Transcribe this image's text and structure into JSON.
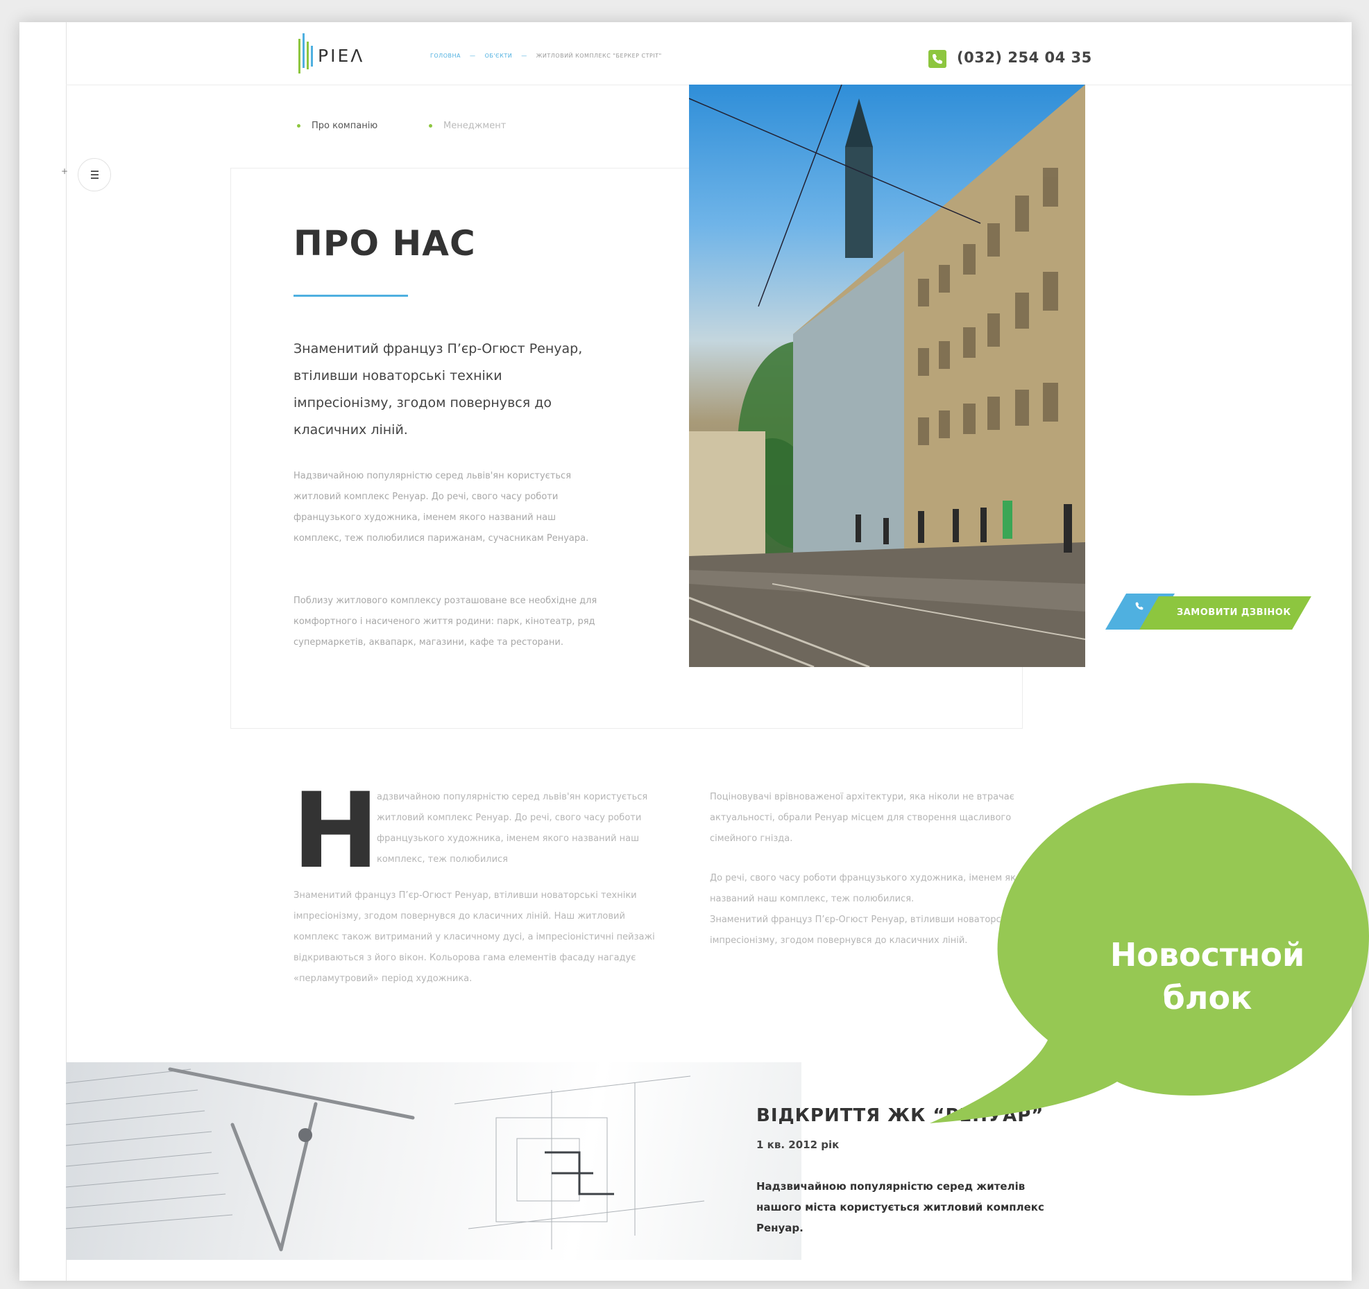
{
  "header": {
    "logo_text": "PIEΛ",
    "breadcrumb": {
      "home": "ГОЛОВНА",
      "sep1": "—",
      "objects": "ОБ'ЄКТИ",
      "sep2": "—",
      "current": "ЖИТЛОВИЙ КОМПЛЕКС \"БЕРКЕР СТРІТ\""
    },
    "phone": "(032) 254 04 35",
    "phone_icon": "phone-icon"
  },
  "subnav": {
    "items": [
      {
        "label": "Про компанію",
        "active": true
      },
      {
        "label": "Менеджмент",
        "active": false
      }
    ]
  },
  "menu": {
    "icon": "hamburger-icon",
    "plus": "+"
  },
  "about": {
    "title": "ПРО НАС",
    "lead": "Знаменитий француз П’єр-Огюст Ренуар, втіливши новаторські техніки імпресіонізму, згодом повернувся до класичних ліній.",
    "p1": "Надзвичайною популярністю серед львів'ян користується житловий комплекс Ренуар. До речі, свого часу роботи французького художника, іменем якого названий наш комплекс, теж полюбилися парижанам, сучасникам Ренуара.",
    "p2": "Поблизу житлового комплексу розташоване все необхідне для комфортного і насиченого життя родини: парк, кінотеатр, ряд супермаркетів, аквапарк, магазини, кафе та ресторани."
  },
  "call_button": {
    "label": "ЗАМОВИТИ ДЗВІНОК",
    "icon": "phone-icon"
  },
  "article": {
    "dropcap": "Н",
    "col1_intro": "адзвичайною популярністю серед львів'ян користується житловий комплекс Ренуар. До речі, свого часу роботи французького художника, іменем якого названий наш комплекс, теж полюбилися",
    "col1_p2": "Знаменитий француз П’єр-Огюст Ренуар, втіливши новаторські техніки імпресіонізму, згодом повернувся до класичних ліній. Наш житловий комплекс також витриманий у класичному дусі, а імпресіоністичні пейзажі відкриваються з його вікон. Кольорова гама елементів фасаду нагадує «перламутровий» період художника.",
    "col2_p1": "Поціновувачі врівноваженої архітектури, яка ніколи не втрачає актуальності, обрали Ренуар місцем для створення щасливого сімейного гнізда.",
    "col2_p2": "До речі, свого часу роботи французького художника, іменем якого названий наш комплекс, теж полюбилися.",
    "col2_p3": "Знаменитий француз П’єр-Огюст Ренуар, втіливши новаторські техніки імпресіонізму, згодом повернувся до класичних ліній."
  },
  "news": {
    "title": "ВІДКРИТТЯ ЖК “РЕНУАР”",
    "date": "1 кв. 2012 рік",
    "desc": "Надзвичайною популярністю серед жителів нашого міста користується житловий комплекс Ренуар."
  },
  "callout": {
    "label": "Новостной блок"
  },
  "colors": {
    "accent_blue": "#4fb0e0",
    "accent_green": "#8dc63f",
    "callout_green": "#96c853"
  }
}
